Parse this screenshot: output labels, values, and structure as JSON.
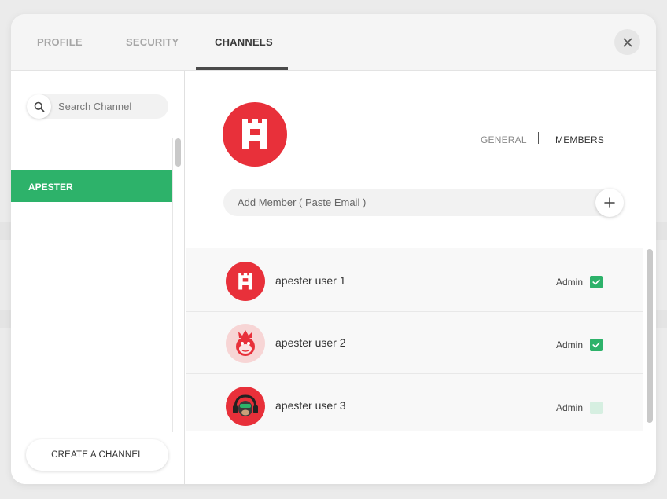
{
  "tabs": [
    {
      "label": "PROFILE"
    },
    {
      "label": "SECURITY"
    },
    {
      "label": "CHANNELS"
    }
  ],
  "active_tab": "CHANNELS",
  "sidebar": {
    "search_placeholder": "Search Channel",
    "channels": [
      {
        "label": "APESTER",
        "selected": true
      }
    ],
    "create_label": "CREATE A CHANNEL"
  },
  "channel": {
    "logo_letter": "A",
    "subtabs": [
      {
        "label": "GENERAL"
      },
      {
        "label": "MEMBERS"
      }
    ],
    "active_subtab": "MEMBERS",
    "add_member_placeholder": "Add Member ( Paste Email )",
    "members": [
      {
        "name": "apester user 1",
        "role": "Admin",
        "admin": true,
        "avatar": "apester-logo-avatar"
      },
      {
        "name": "apester user 2",
        "role": "Admin",
        "admin": true,
        "avatar": "monkey-avatar"
      },
      {
        "name": "apester user 3",
        "role": "Admin",
        "admin": false,
        "avatar": "headphone-monkey-avatar"
      }
    ]
  },
  "colors": {
    "accent_green": "#2db26a",
    "brand_red": "#e8303a"
  },
  "icons": {
    "search": "search-icon",
    "close": "close-icon",
    "add": "plus-icon",
    "check": "check-icon"
  }
}
